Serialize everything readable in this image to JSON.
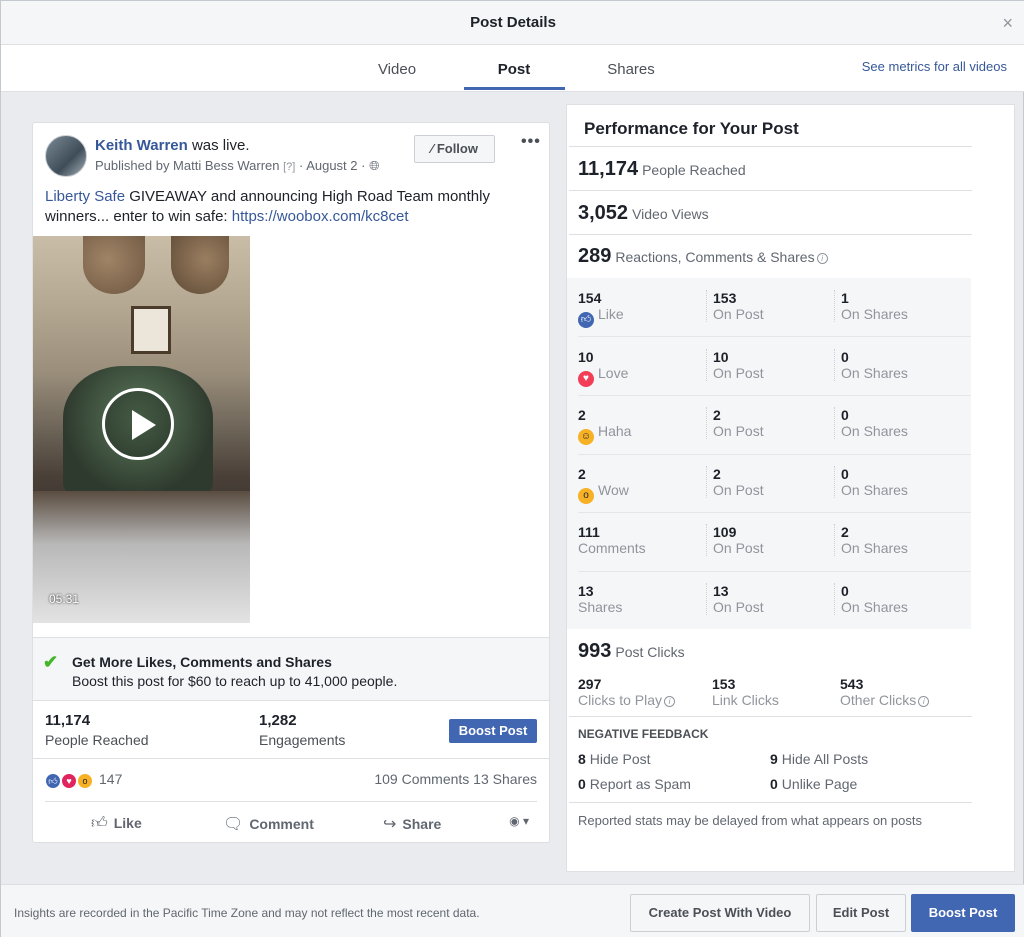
{
  "header": {
    "title": "Post Details",
    "close_glyph": "×"
  },
  "tabs": [
    {
      "label": "Video",
      "active": false
    },
    {
      "label": "Post",
      "active": true
    },
    {
      "label": "Shares",
      "active": false
    }
  ],
  "see_metrics_link": "See metrics for all videos",
  "post": {
    "author": "Keith Warren",
    "author_suffix": "was live.",
    "published_by": "Published by Matti Bess Warren",
    "published_q": "[?]",
    "date": "· August 2 ·",
    "globe_icon": "globe-icon",
    "follow_label": "Follow",
    "more_glyph": "•••",
    "text_link1": "Liberty Safe",
    "text_body": " GIVEAWAY and announcing High Road Team monthly winners... enter to win safe: ",
    "text_link2": "https://woobox.com/kc8cet",
    "video_duration": "05:31",
    "promo_title": "Get More Likes, Comments and Shares",
    "promo_sub": "Boost this post for $60 to reach up to 41,000 people.",
    "stats": {
      "reached_value": "11,174",
      "reached_label": "People Reached",
      "engagements_value": "1,282",
      "engagements_label": "Engagements",
      "boost_label": "Boost Post"
    },
    "reactions_count": "147",
    "comments_shares": "109 Comments  13 Shares",
    "actions": {
      "like": "Like",
      "comment": "Comment",
      "share": "Share"
    }
  },
  "performance": {
    "title": "Performance for Your Post",
    "people_reached_value": "11,174",
    "people_reached_label": "People Reached",
    "video_views_value": "3,052",
    "video_views_label": "Video Views",
    "rcs_value": "289",
    "rcs_label": "Reactions, Comments & Shares",
    "rows": [
      {
        "v1": "154",
        "l1": "Like",
        "v2": "153",
        "l2": "On Post",
        "v3": "1",
        "l3": "On Shares"
      },
      {
        "v1": "10",
        "l1": "Love",
        "v2": "10",
        "l2": "On Post",
        "v3": "0",
        "l3": "On Shares"
      },
      {
        "v1": "2",
        "l1": "Haha",
        "v2": "2",
        "l2": "On Post",
        "v3": "0",
        "l3": "On Shares"
      },
      {
        "v1": "2",
        "l1": "Wow",
        "v2": "2",
        "l2": "On Post",
        "v3": "0",
        "l3": "On Shares"
      },
      {
        "v1": "111",
        "l1": "Comments",
        "v2": "109",
        "l2": "On Post",
        "v3": "2",
        "l3": "On Shares"
      },
      {
        "v1": "13",
        "l1": "Shares",
        "v2": "13",
        "l2": "On Post",
        "v3": "0",
        "l3": "On Shares"
      }
    ],
    "post_clicks_value": "993",
    "post_clicks_label": "Post Clicks",
    "clicks": [
      {
        "value": "297",
        "label": "Clicks to Play"
      },
      {
        "value": "153",
        "label": "Link Clicks"
      },
      {
        "value": "543",
        "label": "Other Clicks"
      }
    ],
    "negative_title": "NEGATIVE FEEDBACK",
    "negative": [
      {
        "value": "8",
        "label": "Hide Post"
      },
      {
        "value": "9",
        "label": "Hide All Posts"
      },
      {
        "value": "0",
        "label": "Report as Spam"
      },
      {
        "value": "0",
        "label": "Unlike Page"
      }
    ],
    "disclaimer": "Reported stats may be delayed from what appears on posts"
  },
  "footer": {
    "note": "Insights are recorded in the Pacific Time Zone and may not reflect the most recent data.",
    "create_post_with_video": "Create Post With Video",
    "edit_post": "Edit Post",
    "boost_post": "Boost Post"
  },
  "colors": {
    "accent": "#4267b2",
    "link": "#365899",
    "check": "#42b72a"
  }
}
